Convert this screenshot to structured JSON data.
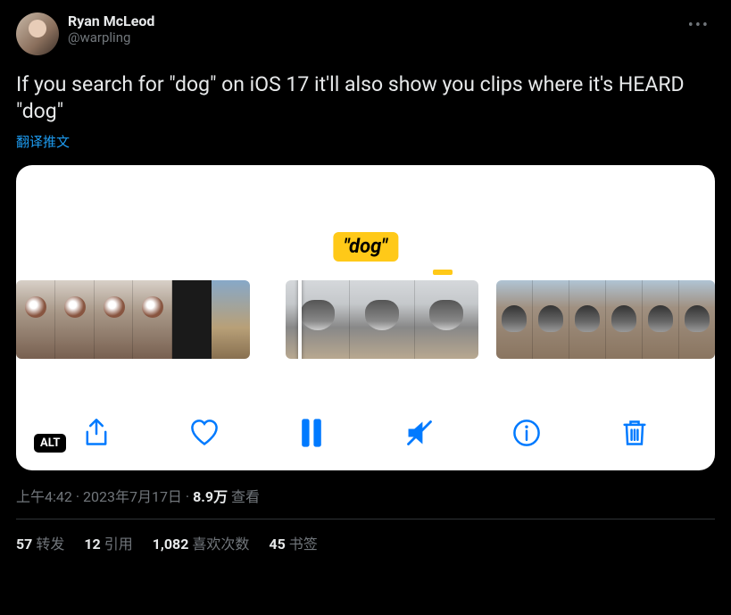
{
  "author": {
    "display_name": "Ryan McLeod",
    "handle": "@warpling"
  },
  "tweet_text": "If you search for \"dog\" on iOS 17 it'll also show you clips where it's HEARD \"dog\"",
  "translate_label": "翻译推文",
  "media": {
    "search_token": "\"dog\"",
    "alt_badge": "ALT"
  },
  "meta": {
    "time": "上午4:42",
    "date": "2023年7月17日",
    "views_count": "8.9万",
    "views_label": "查看"
  },
  "stats": {
    "retweets": {
      "count": "57",
      "label": "转发"
    },
    "quotes": {
      "count": "12",
      "label": "引用"
    },
    "likes": {
      "count": "1,082",
      "label": "喜欢次数"
    },
    "bookmarks": {
      "count": "45",
      "label": "书签"
    }
  }
}
